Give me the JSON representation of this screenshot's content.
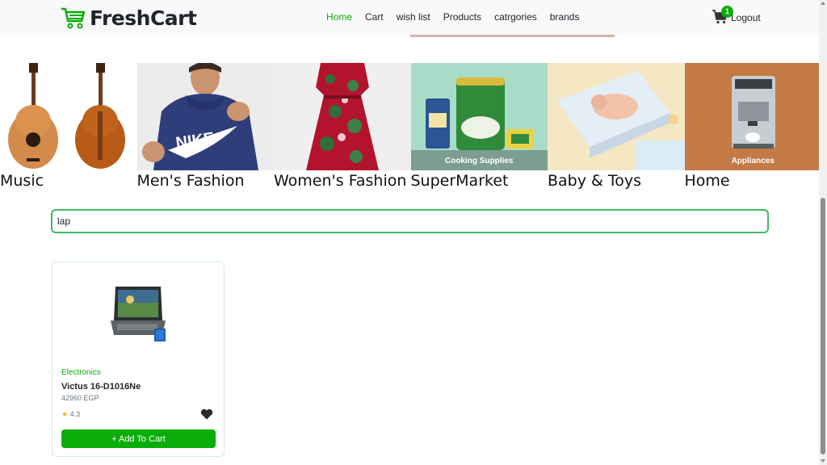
{
  "brand": {
    "name": "FreshCart",
    "icon": "cart-icon"
  },
  "nav": {
    "links": [
      {
        "label": "Home",
        "active": true
      },
      {
        "label": "Cart",
        "active": false
      },
      {
        "label": "wish list",
        "active": false
      },
      {
        "label": "Products",
        "active": false
      },
      {
        "label": "catrgories",
        "active": false
      },
      {
        "label": "brands",
        "active": false
      }
    ],
    "cart_count": "1",
    "logout_label": "Logout"
  },
  "categories": [
    {
      "name": "Music",
      "overlay": ""
    },
    {
      "name": "Men's Fashion",
      "overlay": ""
    },
    {
      "name": "Women's Fashion",
      "overlay": ""
    },
    {
      "name": "SuperMarket",
      "overlay": "Cooking Supplies"
    },
    {
      "name": "Baby & Toys",
      "overlay": ""
    },
    {
      "name": "Home",
      "overlay": "Appliances"
    }
  ],
  "search": {
    "value": "lap",
    "placeholder": ""
  },
  "products": [
    {
      "category": "Electronics",
      "name": "Victus 16-D1016Ne",
      "price": "42960 EGP",
      "rating": "4.3",
      "add_label": "+ Add To Cart"
    }
  ],
  "colors": {
    "accent": "#0aad0a",
    "search_border": "#3cbb63",
    "navbar_bg": "#f8f9fa"
  }
}
